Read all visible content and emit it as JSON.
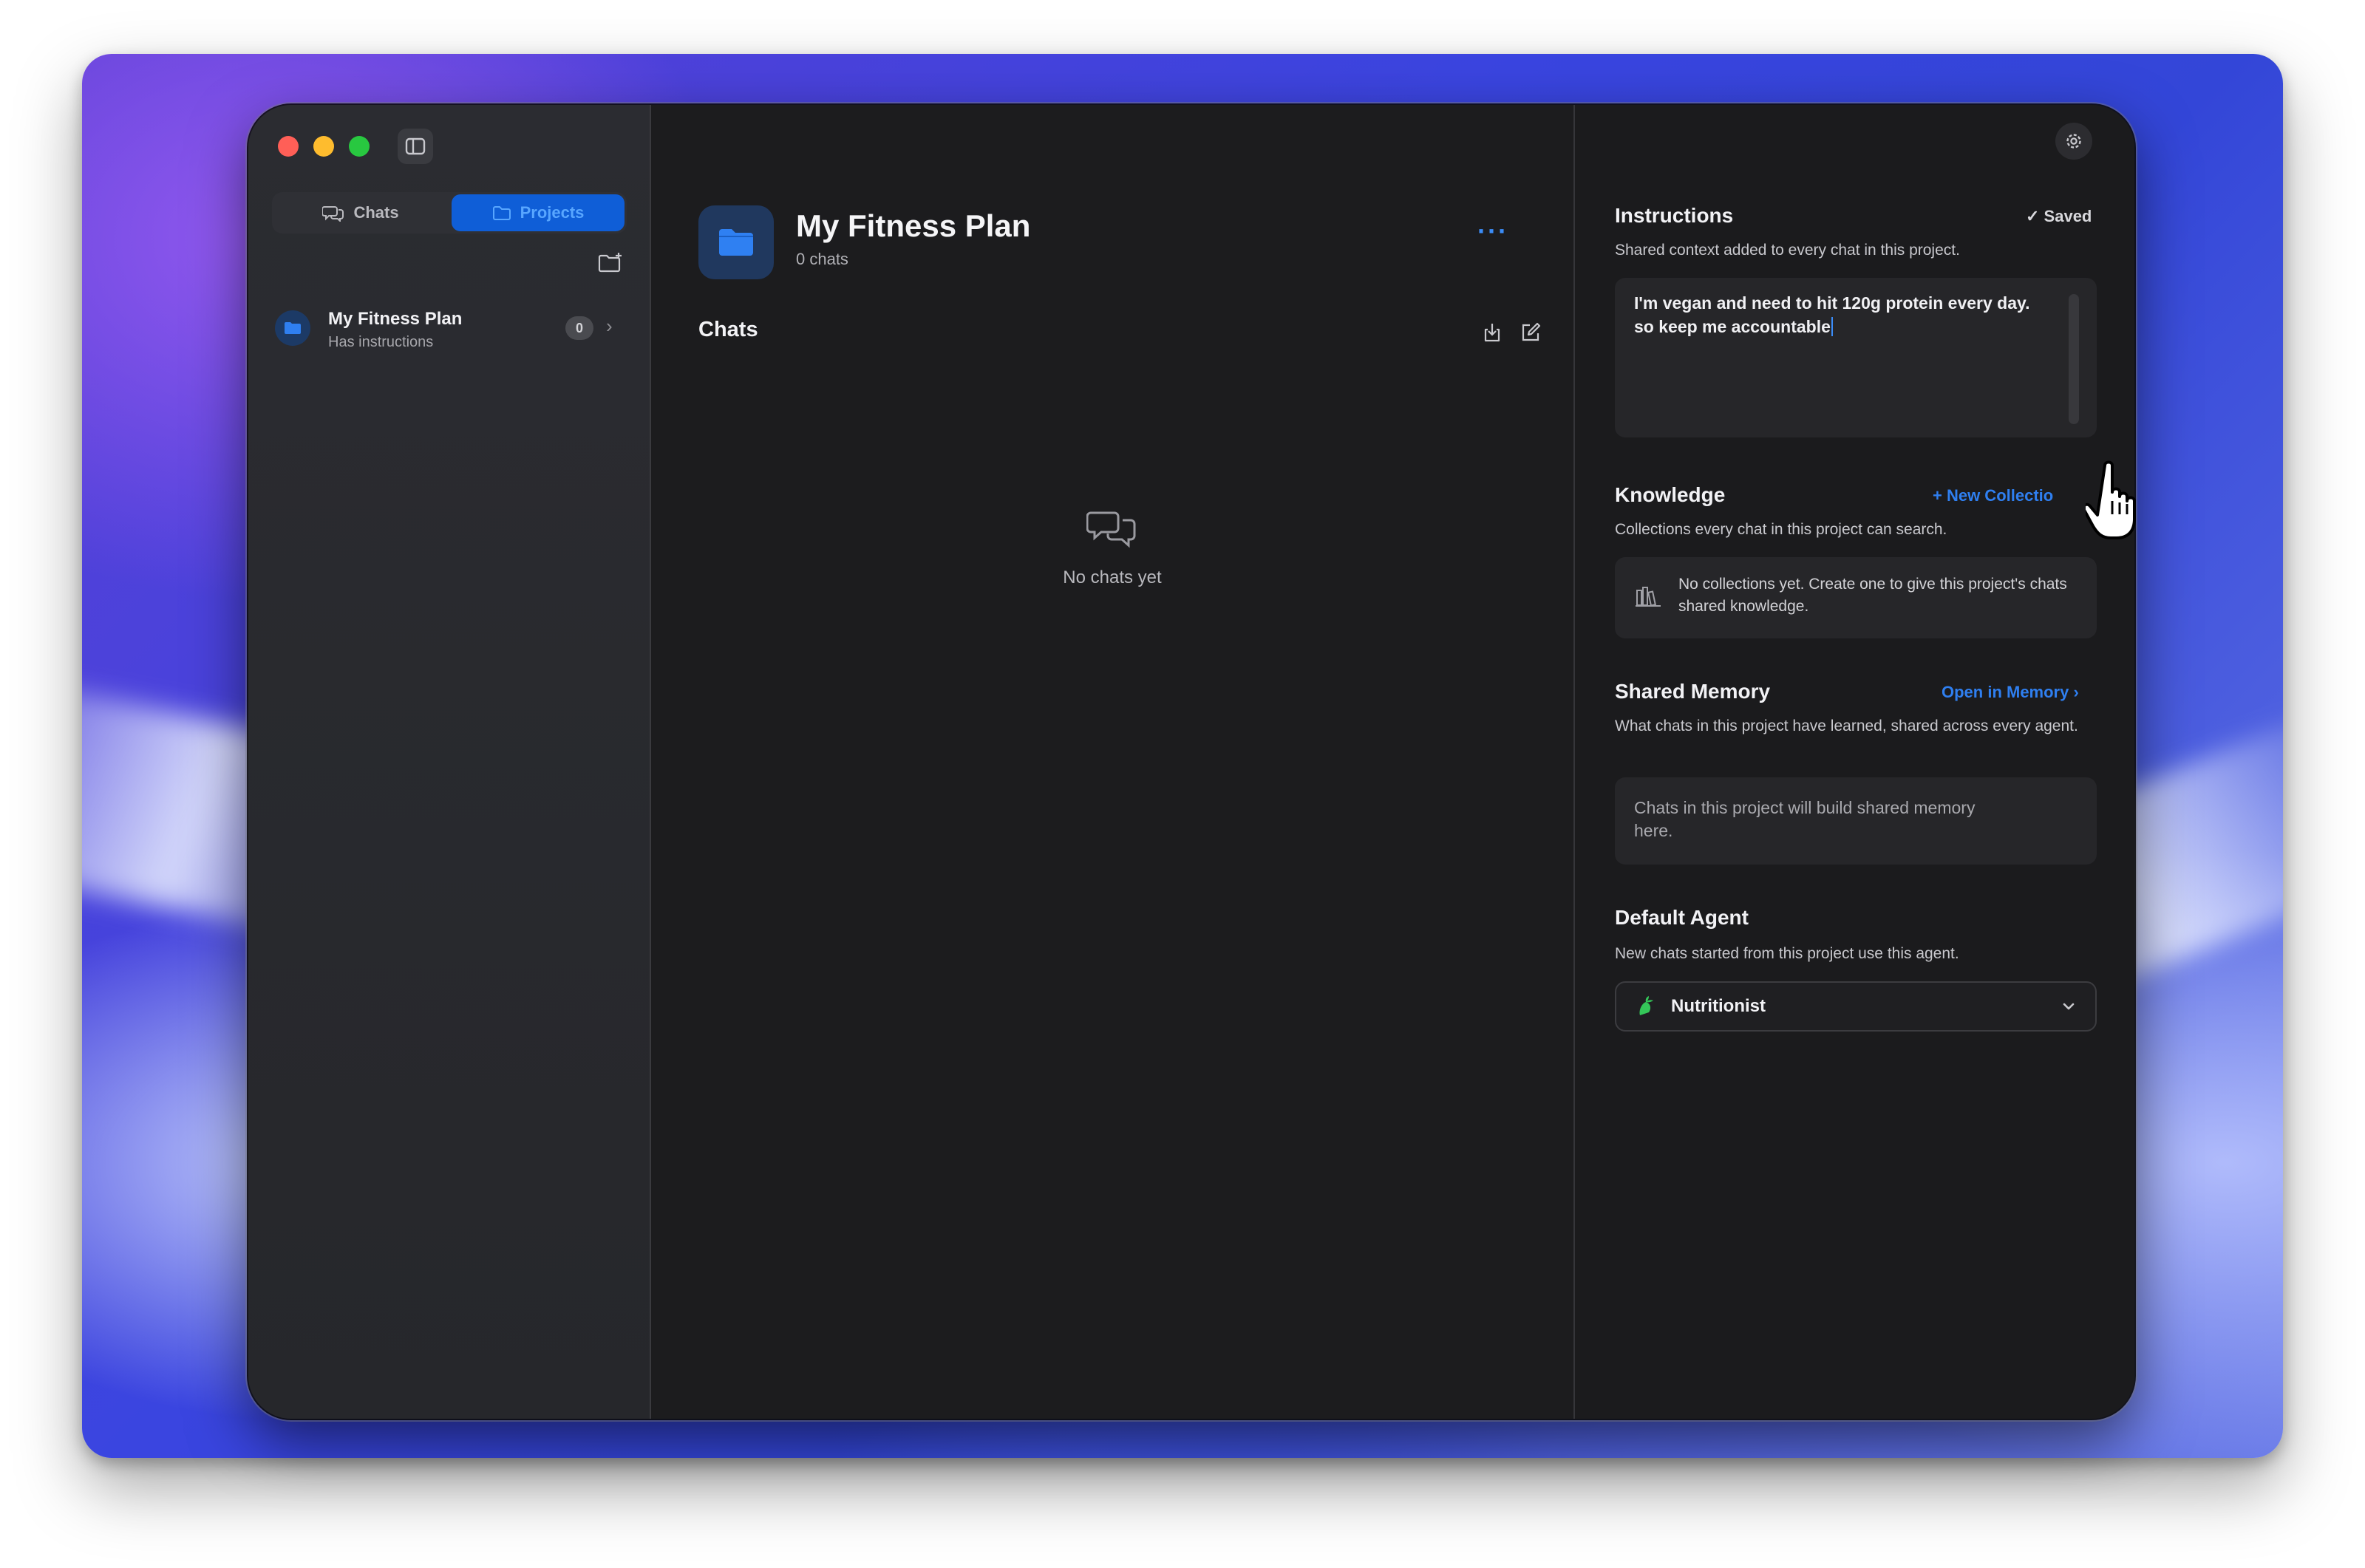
{
  "sidebar": {
    "tabs": [
      {
        "label": "Chats",
        "icon": "chat-bubbles-icon",
        "active": false
      },
      {
        "label": "Projects",
        "icon": "folder-icon",
        "active": true
      }
    ],
    "projects": [
      {
        "title": "My Fitness Plan",
        "subtitle": "Has instructions",
        "count": "0"
      }
    ]
  },
  "main": {
    "title": "My Fitness Plan",
    "subtitle": "0 chats",
    "more": "···",
    "chats_header": "Chats",
    "empty_text": "No chats yet"
  },
  "panel": {
    "instructions": {
      "title": "Instructions",
      "status": "✓ Saved",
      "description": "Shared context added to every chat in this project.",
      "value": "I'm vegan and need to hit 120g protein every day. so keep me accountable"
    },
    "knowledge": {
      "title": "Knowledge",
      "action": "+ New Collectio",
      "description": "Collections every chat in this project can search.",
      "empty": "No collections yet. Create one to give this project's chats shared knowledge."
    },
    "memory": {
      "title": "Shared Memory",
      "action": "Open in Memory ›",
      "description": "What chats in this project have learned, shared across every agent.",
      "placeholder": "Chats in this project will build shared memory here."
    },
    "agent": {
      "title": "Default Agent",
      "description": "New chats started from this project use this agent.",
      "selected": "Nutritionist"
    }
  },
  "colors": {
    "accent": "#2f7ff0",
    "active_tab_bg": "#0f5ed7",
    "window_bg": "#1c1c1e",
    "agent_icon": "#34c759"
  }
}
